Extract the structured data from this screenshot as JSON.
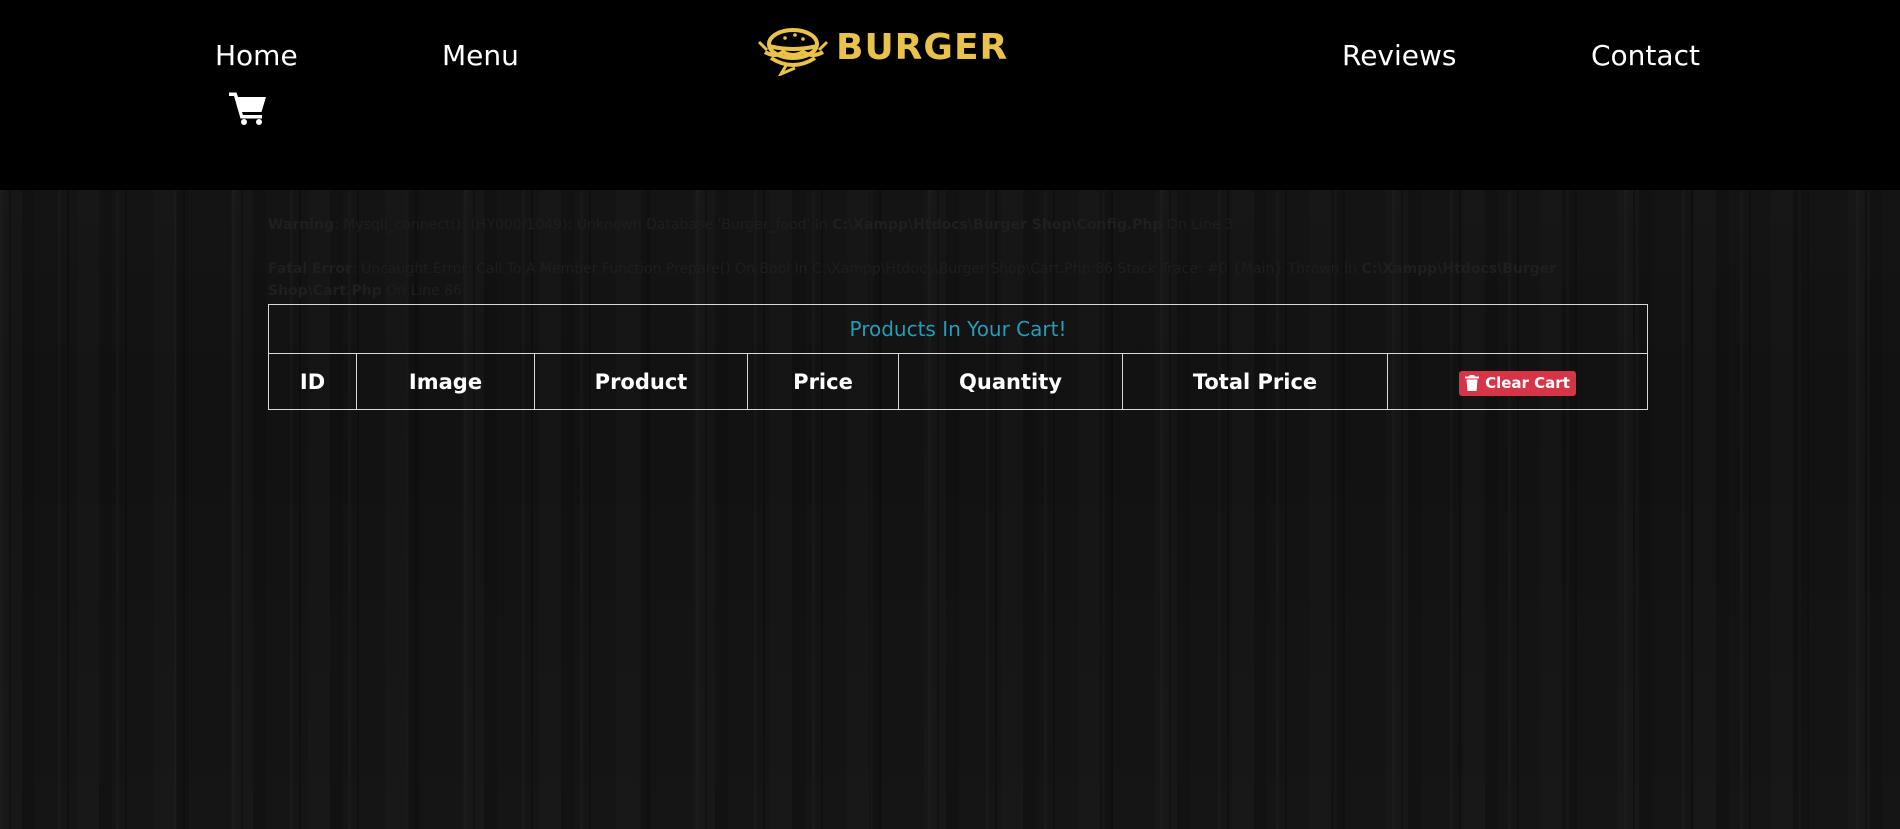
{
  "nav": {
    "home": "Home",
    "menu": "Menu",
    "reviews": "Reviews",
    "contact": "Contact",
    "cart_icon": "shopping-cart-icon"
  },
  "logo": {
    "text": "BURGER",
    "icon": "burger-logo-icon",
    "color": "#e9c24b"
  },
  "errors": {
    "warning_label": "Warning",
    "warning_text": ": Mysqli_connect(): (HY000/1049): Unknown Database 'Burger_food' In ",
    "warning_path": "C:\\Xampp\\Htdocs\\Burger Shop\\Config.Php",
    "warning_suffix": " On Line 3",
    "fatal_label": "Fatal Error",
    "fatal_text": ": Uncaught Error: Call To A Member Function Prepare() On Bool In C:\\Xampp\\Htdocs\\Burger Shop\\Cart.Php:86 Stack Trace: #0 {Main} Thrown In ",
    "fatal_path": "C:\\Xampp\\Htdocs\\Burger Shop\\Cart.Php",
    "fatal_suffix": " On Line 86"
  },
  "cart": {
    "title": "Products In Your Cart!",
    "title_color": "#2a9bb6",
    "columns": [
      "ID",
      "Image",
      "Product",
      "Price",
      "Quantity",
      "Total Price"
    ],
    "clear_button": "Clear Cart",
    "clear_icon": "trash-icon",
    "clear_color": "#d63447"
  }
}
